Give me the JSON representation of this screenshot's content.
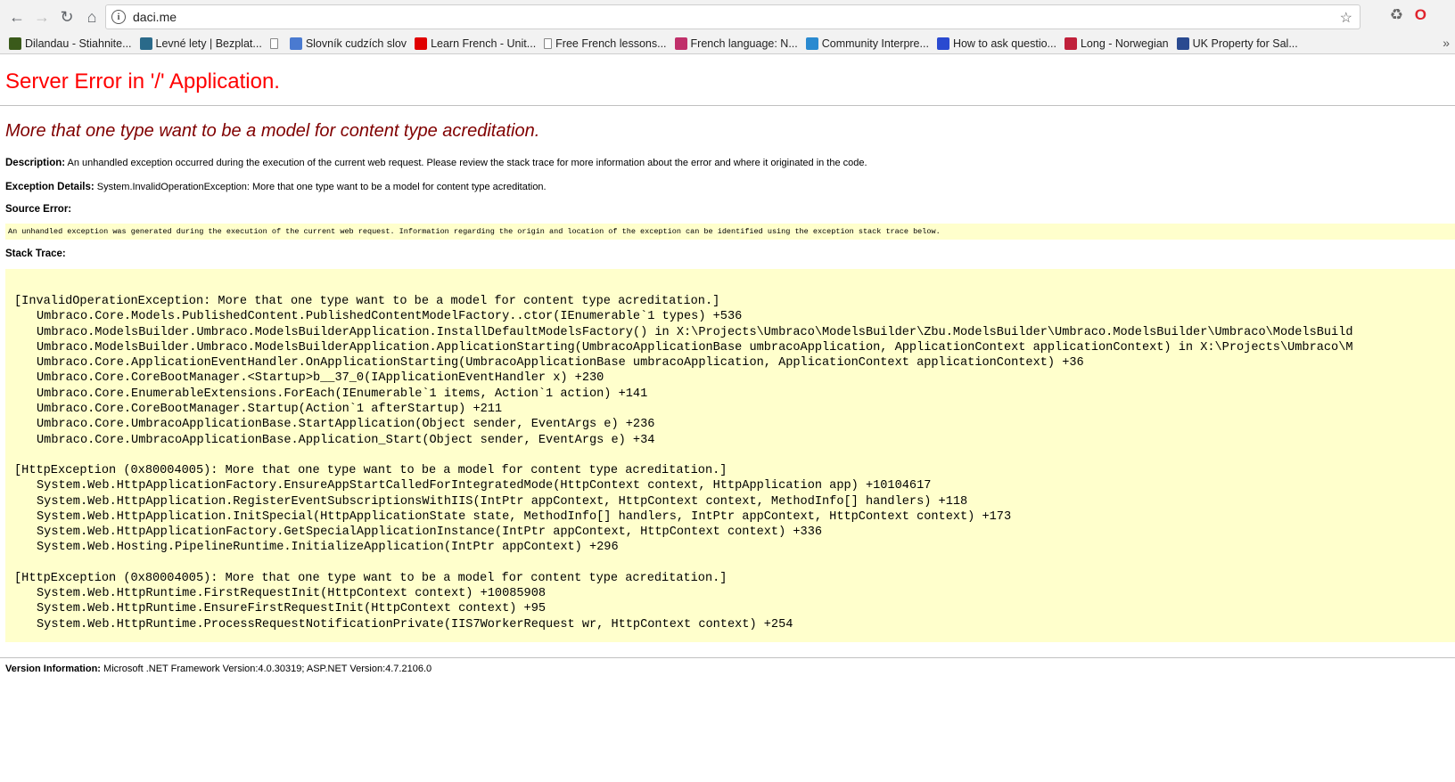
{
  "browser": {
    "url": "daci.me",
    "bookmarks": [
      {
        "label": "Dilandau - Stiahnite...",
        "icon": "dilandau-favicon-icon",
        "color": "#3a5a1a"
      },
      {
        "label": "Levné lety | Bezplat...",
        "icon": "flights-favicon-icon",
        "color": "#2a6a8a"
      },
      {
        "label": "",
        "icon": "document-icon",
        "color": "#ffffff"
      },
      {
        "label": "Slovník cudzích slov",
        "icon": "scs-favicon-icon",
        "color": "#4a7ad0"
      },
      {
        "label": "Learn French - Unit...",
        "icon": "youtube-icon",
        "color": "#e00000"
      },
      {
        "label": "Free French lessons...",
        "icon": "document-icon",
        "color": "#ffffff"
      },
      {
        "label": "French language: N...",
        "icon": "feather-icon",
        "color": "#c0306a"
      },
      {
        "label": "Community Interpre...",
        "icon": "globe-icon",
        "color": "#2a8ad0"
      },
      {
        "label": "How to ask questio...",
        "icon": "french-flag-icon",
        "color": "#2a4ad0"
      },
      {
        "label": "Long - Norwegian",
        "icon": "norwegian-flag-icon",
        "color": "#c0203a"
      },
      {
        "label": "UK Property for Sal...",
        "icon": "us-favicon-icon",
        "color": "#2a4a90"
      }
    ]
  },
  "error": {
    "title": "Server Error in '/' Application.",
    "message": "More that one type want to be a model for content type acreditation.",
    "description_label": "Description:",
    "description_text": "An unhandled exception occurred during the execution of the current web request. Please review the stack trace for more information about the error and where it originated in the code.",
    "exception_label": "Exception Details:",
    "exception_text": "System.InvalidOperationException: More that one type want to be a model for content type acreditation.",
    "source_label": "Source Error:",
    "source_text": "An unhandled exception was generated during the execution of the current web request. Information regarding the origin and location of the exception can be identified using the exception stack trace below.",
    "stack_label": "Stack Trace:",
    "stack_blocks": [
      {
        "header": "[InvalidOperationException: More that one type want to be a model for content type acreditation.]",
        "frames": [
          "Umbraco.Core.Models.PublishedContent.PublishedContentModelFactory..ctor(IEnumerable`1 types) +536",
          "Umbraco.ModelsBuilder.Umbraco.ModelsBuilderApplication.InstallDefaultModelsFactory() in X:\\Projects\\Umbraco\\ModelsBuilder\\Zbu.ModelsBuilder\\Umbraco.ModelsBuilder\\Umbraco\\ModelsBuild",
          "Umbraco.ModelsBuilder.Umbraco.ModelsBuilderApplication.ApplicationStarting(UmbracoApplicationBase umbracoApplication, ApplicationContext applicationContext) in X:\\Projects\\Umbraco\\M",
          "Umbraco.Core.ApplicationEventHandler.OnApplicationStarting(UmbracoApplicationBase umbracoApplication, ApplicationContext applicationContext) +36",
          "Umbraco.Core.CoreBootManager.<Startup>b__37_0(IApplicationEventHandler x) +230",
          "Umbraco.Core.EnumerableExtensions.ForEach(IEnumerable`1 items, Action`1 action) +141",
          "Umbraco.Core.CoreBootManager.Startup(Action`1 afterStartup) +211",
          "Umbraco.Core.UmbracoApplicationBase.StartApplication(Object sender, EventArgs e) +236",
          "Umbraco.Core.UmbracoApplicationBase.Application_Start(Object sender, EventArgs e) +34"
        ]
      },
      {
        "header": "[HttpException (0x80004005): More that one type want to be a model for content type acreditation.]",
        "frames": [
          "System.Web.HttpApplicationFactory.EnsureAppStartCalledForIntegratedMode(HttpContext context, HttpApplication app) +10104617",
          "System.Web.HttpApplication.RegisterEventSubscriptionsWithIIS(IntPtr appContext, HttpContext context, MethodInfo[] handlers) +118",
          "System.Web.HttpApplication.InitSpecial(HttpApplicationState state, MethodInfo[] handlers, IntPtr appContext, HttpContext context) +173",
          "System.Web.HttpApplicationFactory.GetSpecialApplicationInstance(IntPtr appContext, HttpContext context) +336",
          "System.Web.Hosting.PipelineRuntime.InitializeApplication(IntPtr appContext) +296"
        ]
      },
      {
        "header": "[HttpException (0x80004005): More that one type want to be a model for content type acreditation.]",
        "frames": [
          "System.Web.HttpRuntime.FirstRequestInit(HttpContext context) +10085908",
          "System.Web.HttpRuntime.EnsureFirstRequestInit(HttpContext context) +95",
          "System.Web.HttpRuntime.ProcessRequestNotificationPrivate(IIS7WorkerRequest wr, HttpContext context) +254"
        ]
      }
    ],
    "version_label": "Version Information:",
    "version_text": "Microsoft .NET Framework Version:4.0.30319; ASP.NET Version:4.7.2106.0"
  }
}
